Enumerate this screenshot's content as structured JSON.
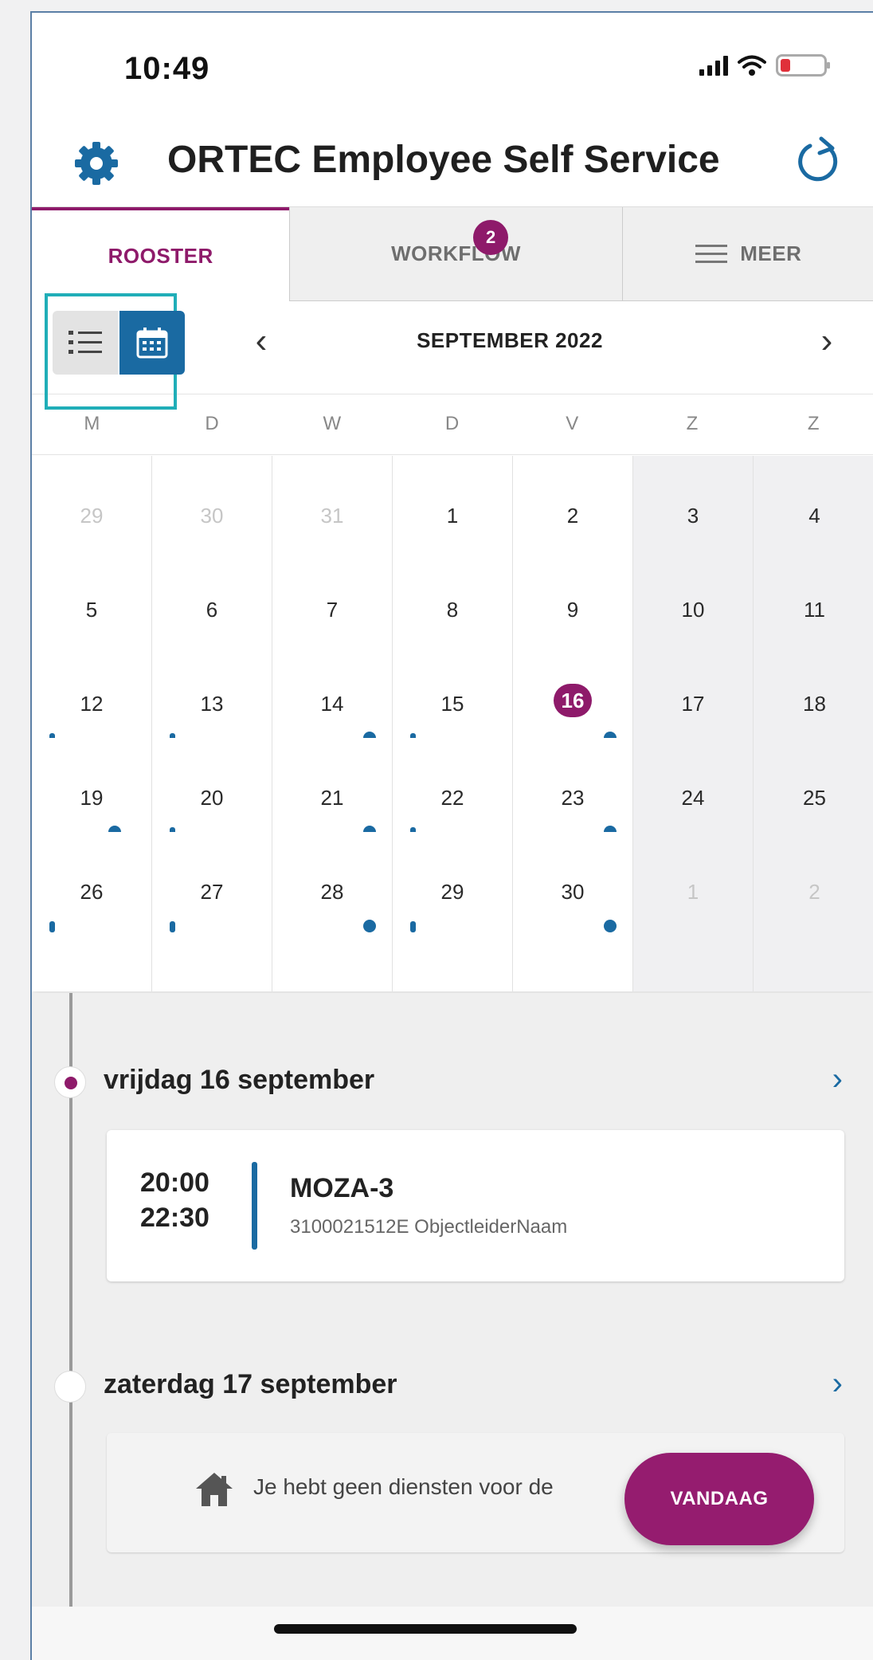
{
  "status_bar": {
    "time": "10:49"
  },
  "app": {
    "title": "ORTEC Employee Self Service"
  },
  "tabs": [
    {
      "label": "ROOSTER",
      "active": true
    },
    {
      "label": "WORKFLOW",
      "badge": "2"
    },
    {
      "label": "MEER"
    }
  ],
  "calendar": {
    "month_label": "SEPTEMBER 2022",
    "prev_label": "‹",
    "next_label": "›",
    "weekdays": [
      "M",
      "D",
      "W",
      "D",
      "V",
      "Z",
      "Z"
    ],
    "weeks": [
      [
        "29",
        "30",
        "31",
        "1",
        "2",
        "3",
        "4"
      ],
      [
        "5",
        "6",
        "7",
        "8",
        "9",
        "10",
        "11"
      ],
      [
        "12",
        "13",
        "14",
        "15",
        "16",
        "17",
        "18"
      ],
      [
        "19",
        "20",
        "21",
        "22",
        "23",
        "24",
        "25"
      ],
      [
        "26",
        "27",
        "28",
        "29",
        "30",
        "1",
        "2"
      ]
    ],
    "today": "16"
  },
  "days": [
    {
      "label": "vrijdag 16 september",
      "shift": {
        "start": "20:00",
        "end": "22:30",
        "title": "MOZA-3",
        "subtitle": "3100021512E ObjectleiderNaam"
      }
    },
    {
      "label": "zaterdag 17 september",
      "empty_text": "Je hebt geen diensten voor de"
    }
  ],
  "fab": {
    "label": "VANDAAG"
  },
  "colors": {
    "primary": "#8e1a6a",
    "accent": "#1a6aa2",
    "highlight": "#20aeb8"
  }
}
